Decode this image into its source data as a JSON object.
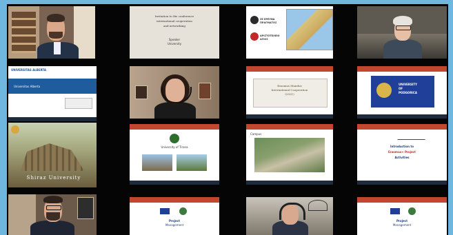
{
  "meeting": {
    "tiles": [
      {
        "id": "r1c1",
        "kind": "video",
        "label": "participant-video"
      },
      {
        "id": "r1c2",
        "kind": "slide",
        "title_lines": [
          "Invitation to the conference",
          "international cooperation",
          "and networking"
        ],
        "footer": "Speaker",
        "footer2": "University"
      },
      {
        "id": "r1c3",
        "kind": "slide",
        "org1": "ΣΕ ΕΡΕΥΝΑ ΠΡΑΓΜΑΤΟΣ",
        "org2": "ΑΡΙΣΤΟΤΕΛΕΙΟ ΑΓΙΟΣ"
      },
      {
        "id": "r1c4",
        "kind": "video",
        "label": "participant-video"
      },
      {
        "id": "r2c1",
        "kind": "slide",
        "brand": "UNIVERSITAS ALBERTA",
        "heading": "Universitas Alberta"
      },
      {
        "id": "r2c2",
        "kind": "video",
        "label": "participant-video"
      },
      {
        "id": "r2c3",
        "kind": "slide",
        "heading_lines": [
          "Erasmus Mundus",
          "International Cooperation",
          "(2021)"
        ]
      },
      {
        "id": "r2c4",
        "kind": "slide",
        "heading_lines": [
          "UNIVERSITY",
          "OF",
          "PODGORICA"
        ]
      },
      {
        "id": "r3c1",
        "kind": "photo",
        "caption": "Shiraz University"
      },
      {
        "id": "r3c2",
        "kind": "slide",
        "heading": "University of Tirana"
      },
      {
        "id": "r3c3",
        "kind": "slide",
        "heading": "Campus"
      },
      {
        "id": "r3c4",
        "kind": "slide",
        "heading_lines": [
          "Introduction to",
          "Erasmus+ Project",
          "Activities"
        ]
      },
      {
        "id": "r4c1",
        "kind": "video",
        "label": "participant-video"
      },
      {
        "id": "r4c2",
        "kind": "slide",
        "heading_lines": [
          "Project",
          "Management"
        ]
      },
      {
        "id": "r4c3",
        "kind": "video",
        "label": "participant-video"
      },
      {
        "id": "r4c4",
        "kind": "slide",
        "heading_lines": [
          "Project",
          "Management"
        ]
      }
    ]
  },
  "colors": {
    "background": "#6fb7df",
    "grid": "#050505",
    "ppt_red": "#c1472f",
    "eu_blue": "#1f3f99"
  }
}
